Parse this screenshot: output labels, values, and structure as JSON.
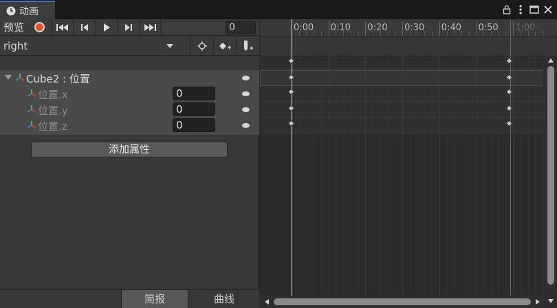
{
  "window": {
    "tab_title": "动画",
    "tab_icon": "clock-icon",
    "controls": [
      "lock-icon",
      "more-icon",
      "maximize-icon",
      "close-icon"
    ]
  },
  "toolbar": {
    "preview_label": "预览",
    "record_color": "#e4522c",
    "buttons": [
      "first-frame-icon",
      "prev-frame-icon",
      "play-icon",
      "next-frame-icon",
      "last-frame-icon"
    ],
    "frame_value": "0"
  },
  "clip": {
    "selected": "right",
    "tools": [
      "add-keyframe-target-icon",
      "add-keyframe-icon",
      "add-event-icon"
    ]
  },
  "properties": [
    {
      "label": "Cube2 : 位置",
      "value": null,
      "level": 0
    },
    {
      "label": "位置.x",
      "value": "0",
      "level": 1
    },
    {
      "label": "位置.y",
      "value": "0",
      "level": 1
    },
    {
      "label": "位置.z",
      "value": "0",
      "level": 1
    }
  ],
  "add_property_label": "添加属性",
  "bottom_tabs": [
    {
      "label": "简报",
      "active": true
    },
    {
      "label": "曲线",
      "active": false
    }
  ],
  "timeline": {
    "ticks": [
      "0:00",
      "0:10",
      "0:20",
      "0:30",
      "0:40",
      "0:50",
      "1:00"
    ],
    "keyframe_times": [
      "0:00",
      "0:59"
    ]
  }
}
